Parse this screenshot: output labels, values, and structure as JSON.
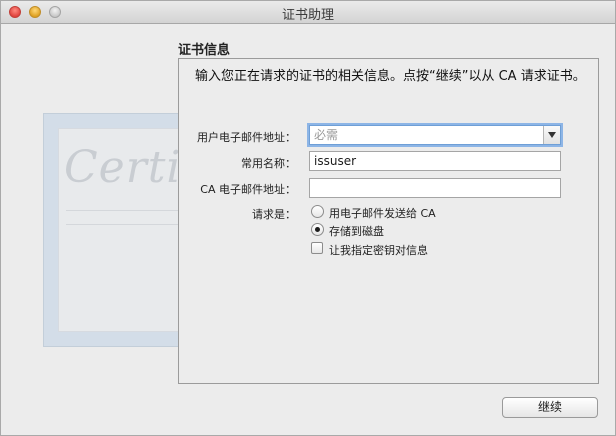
{
  "window": {
    "title": "证书助理"
  },
  "section": {
    "header": "证书信息"
  },
  "intro_text": "输入您正在请求的证书的相关信息。点按“继续”以从 CA 请求证书。",
  "form": {
    "email_label": "用户电子邮件地址：",
    "email_placeholder": "必需",
    "common_name_label": "常用名称：",
    "common_name_value": "issuser",
    "ca_email_label": "CA 电子邮件地址：",
    "ca_email_value": "",
    "request_label": "请求是：",
    "options": [
      {
        "label": "用电子邮件发送给 CA",
        "selected": false
      },
      {
        "label": "存储到磁盘",
        "selected": true
      }
    ],
    "key_pair_label": "让我指定密钥对信息",
    "key_pair_checked": false
  },
  "buttons": {
    "continue": "继续"
  },
  "artwork": {
    "script_text": "Certificate"
  }
}
